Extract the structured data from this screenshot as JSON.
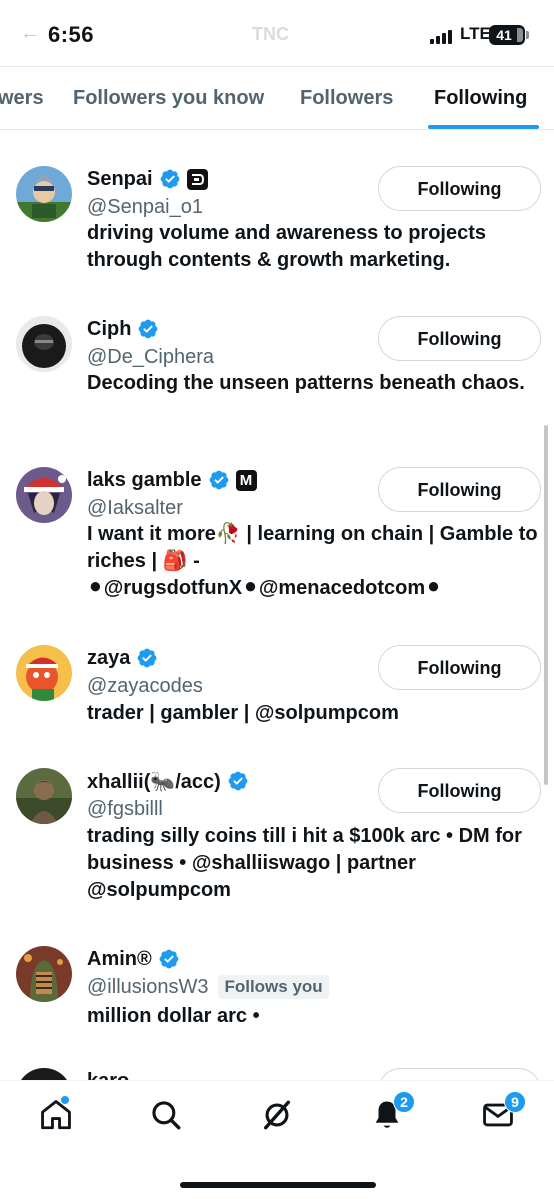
{
  "status_bar": {
    "time": "6:56",
    "back_label": "←",
    "center_text": "TNC",
    "network": "LTE",
    "battery": "41"
  },
  "tabs": [
    {
      "label": "wers"
    },
    {
      "label": "Followers you know"
    },
    {
      "label": "Followers"
    },
    {
      "label": "Following",
      "active": true
    }
  ],
  "button_label": "Following",
  "users": [
    {
      "name": "Senpai",
      "handle": "@Senpai_o1",
      "badge": "org-square",
      "bio": "driving volume and awareness to projects through contents & growth marketing."
    },
    {
      "name": "Ciph",
      "handle": "@De_Ciphera",
      "bio": "Decoding the unseen patterns beneath chaos."
    },
    {
      "name": "laks gamble",
      "handle": "@Iaksalter",
      "badge": "M",
      "bio": "I want it more🥀 | learning on chain | Gamble to riches | 🎒 - ⚫@rugsdotfunX⚫@menacedotcom⚫"
    },
    {
      "name": "zaya",
      "handle": "@zayacodes",
      "bio": "trader | gambler | @solpumpcom"
    },
    {
      "name": "xhallii(🐜/acc)",
      "handle": "@fgsbilll",
      "bio": "trading silly coins till i hit a $100k arc • DM for business • @shalliiswago | partner @solpumpcom"
    },
    {
      "name": "Amin®",
      "handle": "@illusionsW3",
      "follows_you": "Follows you",
      "bio": "million dollar arc •"
    },
    {
      "name": "karo",
      "handle": "",
      "bio": ""
    }
  ],
  "bottom_nav": {
    "items": [
      "home-icon",
      "search-icon",
      "grok-icon",
      "notifications-icon",
      "messages-icon"
    ],
    "notifications_count": "2",
    "messages_count": "9"
  },
  "colors": {
    "accent": "#1d9bf0",
    "verified": "#1d9bf0",
    "text": "#0f1419",
    "secondary": "#536471"
  }
}
